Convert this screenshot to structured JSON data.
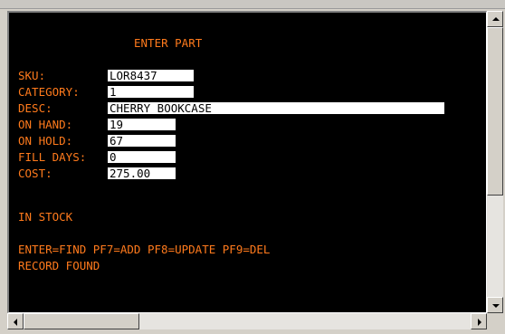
{
  "screen": {
    "title": "ENTER PART",
    "fields": [
      {
        "label": "SKU:",
        "value": "LOR8437"
      },
      {
        "label": "CATEGORY:",
        "value": "1"
      },
      {
        "label": "DESC:",
        "value": "CHERRY BOOKCASE"
      },
      {
        "label": "ON HAND:",
        "value": "19"
      },
      {
        "label": "ON HOLD:",
        "value": "67"
      },
      {
        "label": "FILL DAYS:",
        "value": "0"
      },
      {
        "label": "COST:",
        "value": "275.00"
      }
    ],
    "status": "IN STOCK",
    "keys": "ENTER=FIND PF7=ADD PF8=UPDATE PF9=DEL",
    "message": "RECORD FOUND"
  },
  "icons": {
    "scroll_up": "arrow-up-icon",
    "scroll_down": "arrow-down-icon",
    "scroll_left": "arrow-left-icon",
    "scroll_right": "arrow-right-icon"
  },
  "colors": {
    "terminal_bg": "#000000",
    "terminal_text": "#ff7a1c",
    "field_bg": "#ffffff",
    "field_text": "#000000"
  }
}
